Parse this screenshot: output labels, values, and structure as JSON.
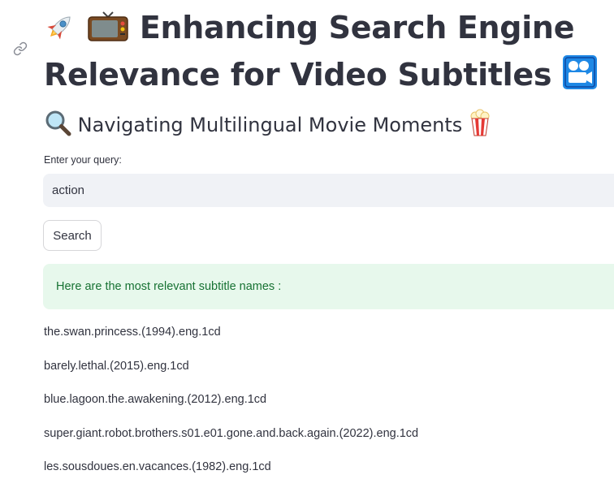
{
  "page": {
    "title": "Enhancing Search Engine Relevance for Video Subtitles",
    "title_leading_icons": [
      "rocket-icon",
      "television-icon"
    ],
    "title_trailing_icon": "movie-camera-icon",
    "subheader": "Navigating Multilingual Movie Moments",
    "subheader_leading_icon": "magnifying-glass-icon",
    "subheader_trailing_icon": "popcorn-icon"
  },
  "search": {
    "label": "Enter your query:",
    "value": "action",
    "button_label": "Search"
  },
  "results": {
    "message": "Here are the most relevant subtitle names :",
    "items": [
      "the.swan.princess.(1994).eng.1cd",
      "barely.lethal.(2015).eng.1cd",
      "blue.lagoon.the.awakening.(2012).eng.1cd",
      "super.giant.robot.brothers.s01.e01.gone.and.back.again.(2022).eng.1cd",
      "les.sousdoues.en.vacances.(1982).eng.1cd"
    ]
  },
  "colors": {
    "text": "#31333f",
    "input_bg": "#f0f2f6",
    "success_bg": "#e7f8ec",
    "success_text": "#177233",
    "button_border": "#d6d6d9"
  }
}
